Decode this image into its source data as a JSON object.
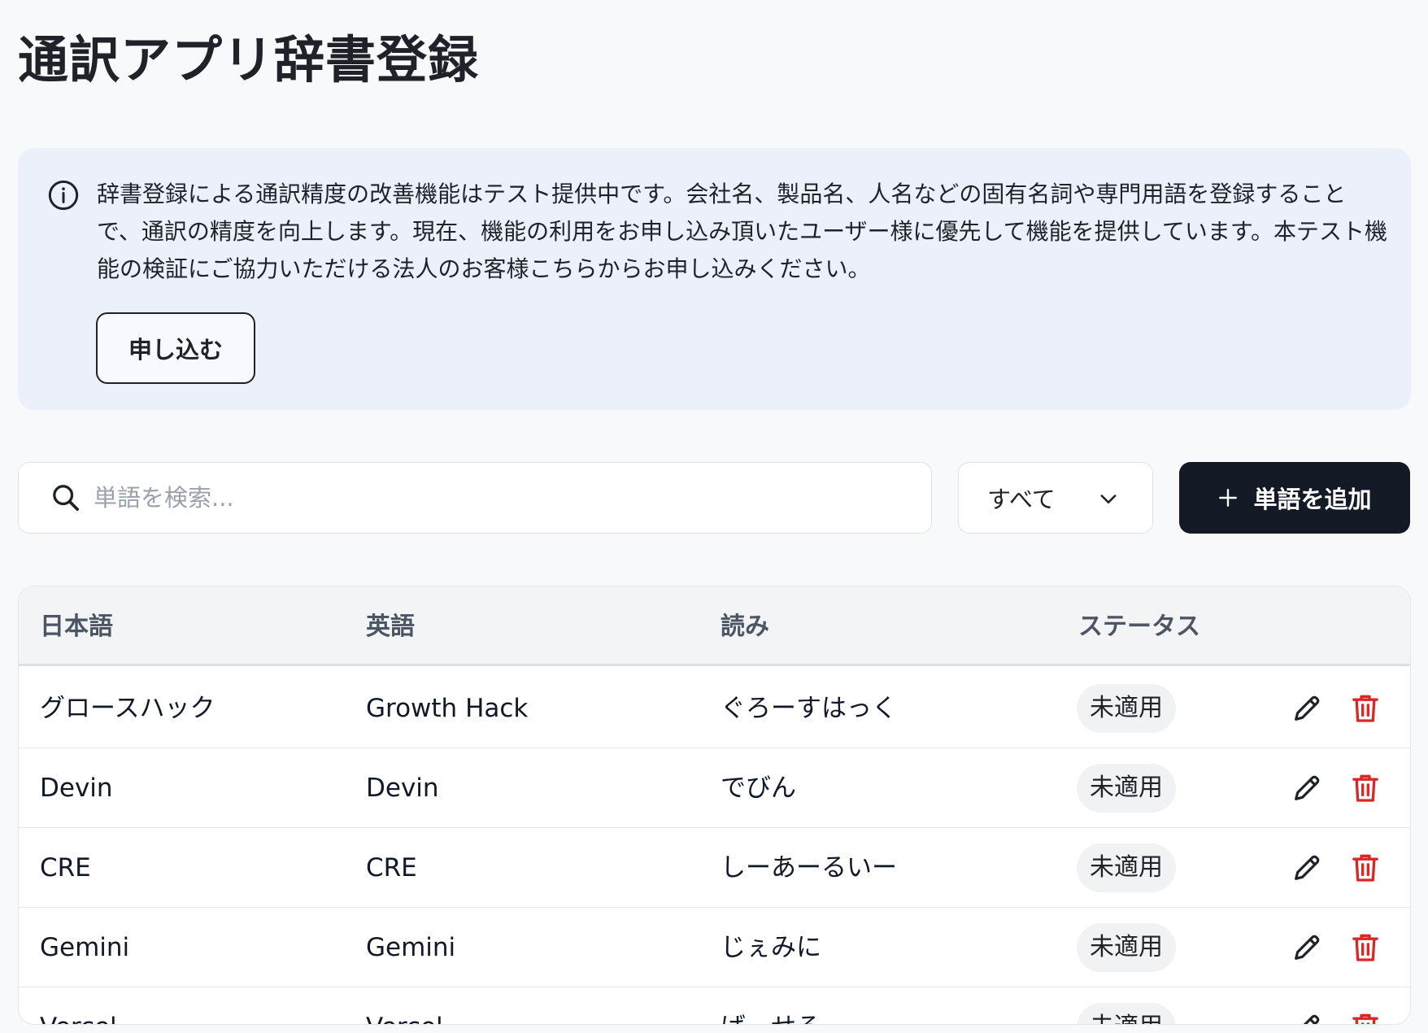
{
  "page": {
    "title": "通訳アプリ辞書登録"
  },
  "notice": {
    "text": "辞書登録による通訳精度の改善機能はテスト提供中です。会社名、製品名、人名などの固有名詞や専門用語を登録することで、通訳の精度を向上します。現在、機能の利用をお申し込み頂いたユーザー様に優先して機能を提供しています。本テスト機能の検証にご協力いただける法人のお客様こちらからお申し込みください。",
    "apply_label": "申し込む"
  },
  "search": {
    "placeholder": "単語を検索...",
    "value": ""
  },
  "filter": {
    "selected": "すべて"
  },
  "add_button": {
    "label": "単語を追加"
  },
  "table": {
    "headers": {
      "japanese": "日本語",
      "english": "英語",
      "reading": "読み",
      "status": "ステータス"
    },
    "rows": [
      {
        "japanese": "グロースハック",
        "english": "Growth Hack",
        "reading": "ぐろーすはっく",
        "status": "未適用"
      },
      {
        "japanese": "Devin",
        "english": "Devin",
        "reading": "でびん",
        "status": "未適用"
      },
      {
        "japanese": "CRE",
        "english": "CRE",
        "reading": "しーあーるいー",
        "status": "未適用"
      },
      {
        "japanese": "Gemini",
        "english": "Gemini",
        "reading": "じぇみに",
        "status": "未適用"
      },
      {
        "japanese": "Vercel",
        "english": "Vercel",
        "reading": "ばーせる",
        "status": "未適用"
      }
    ]
  },
  "colors": {
    "primary": "#131a26",
    "notice_bg": "#ebf0fb",
    "delete": "#dc2626",
    "badge_bg": "#f1f2f4"
  },
  "icons": {
    "notice": "info-icon",
    "search": "search-icon",
    "filter": "chevron-down-icon",
    "add": "plus-icon",
    "edit": "pencil-icon",
    "delete": "trash-icon"
  }
}
